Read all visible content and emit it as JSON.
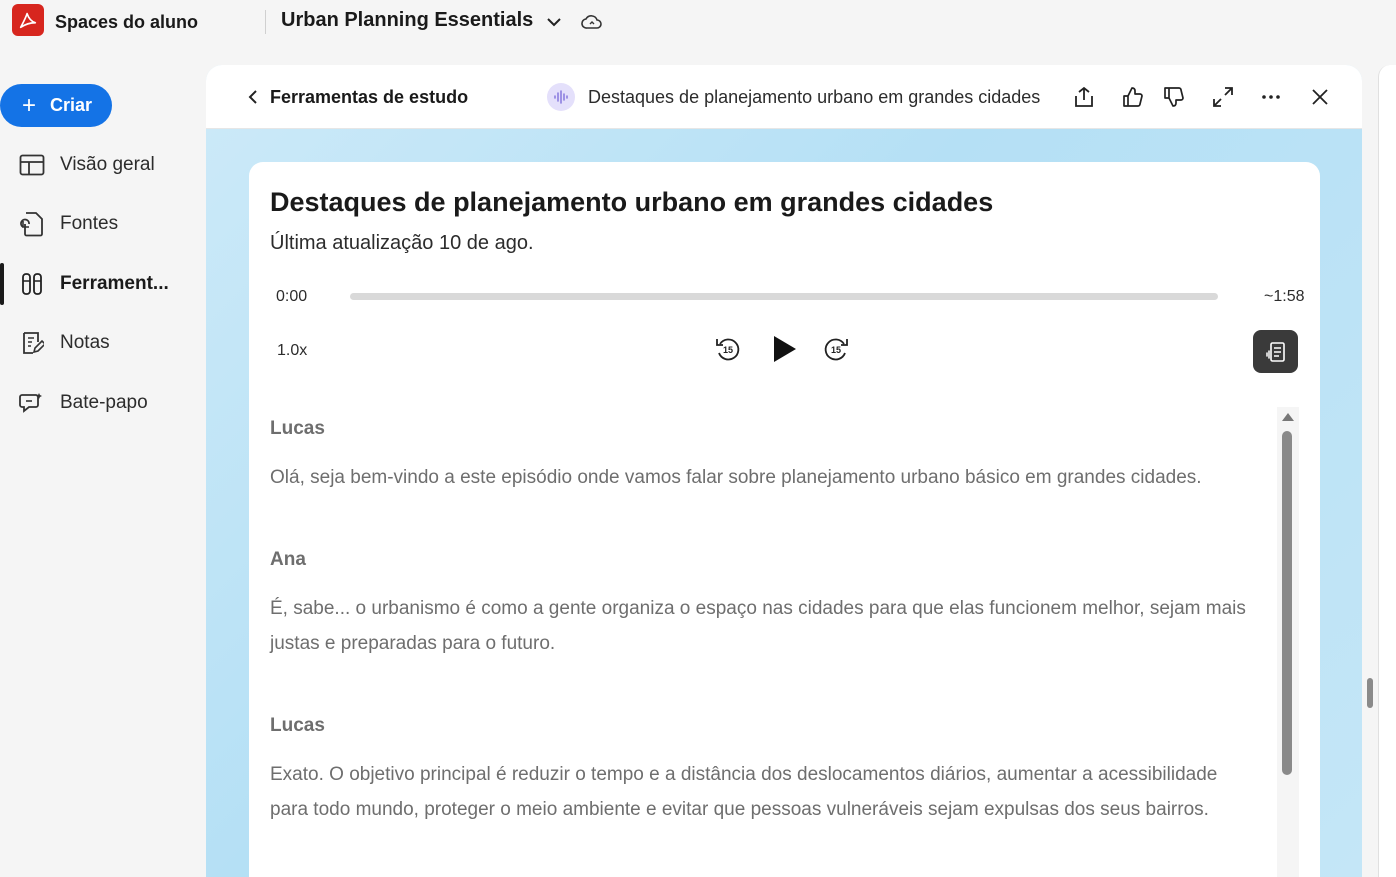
{
  "app": {
    "name": "Spaces do aluno",
    "project_title": "Urban Planning Essentials"
  },
  "sidebar": {
    "create_label": "Criar",
    "items": [
      {
        "label": "Visão geral",
        "icon": "overview-icon"
      },
      {
        "label": "Fontes",
        "icon": "sources-icon"
      },
      {
        "label": "Ferrament...",
        "icon": "tools-icon",
        "active": true
      },
      {
        "label": "Notas",
        "icon": "notes-icon"
      },
      {
        "label": "Bate-papo",
        "icon": "chat-icon"
      }
    ]
  },
  "panel": {
    "back_label": "Ferramentas de estudo",
    "header_title": "Destaques de planejamento urbano em grandes cidades"
  },
  "card": {
    "title": "Destaques de planejamento urbano em grandes cidades",
    "subtitle": "Última atualização 10 de ago.",
    "player": {
      "current_time": "0:00",
      "total_time": "~1:58",
      "progress": 0,
      "speed": "1.0x",
      "skip_back": "15",
      "skip_forward": "15"
    },
    "transcript": [
      {
        "speaker": "Lucas",
        "text": "Olá, seja bem-vindo a este episódio onde vamos falar sobre planejamento urbano básico em grandes cidades."
      },
      {
        "speaker": "Ana",
        "text": "É, sabe... o urbanismo é como a gente organiza o espaço nas cidades para que elas funcionem melhor, sejam mais justas e preparadas para o futuro."
      },
      {
        "speaker": "Lucas",
        "text": "Exato. O objetivo principal é reduzir o tempo e a distância dos deslocamentos diários, aumentar a acessibilidade para todo mundo, proteger o meio ambiente e evitar que pessoas vulneráveis sejam expulsas dos seus bairros."
      }
    ]
  },
  "colors": {
    "accent": "#1473e6",
    "brand": "#d7261e",
    "panel_bg": "#bfe5f7"
  }
}
